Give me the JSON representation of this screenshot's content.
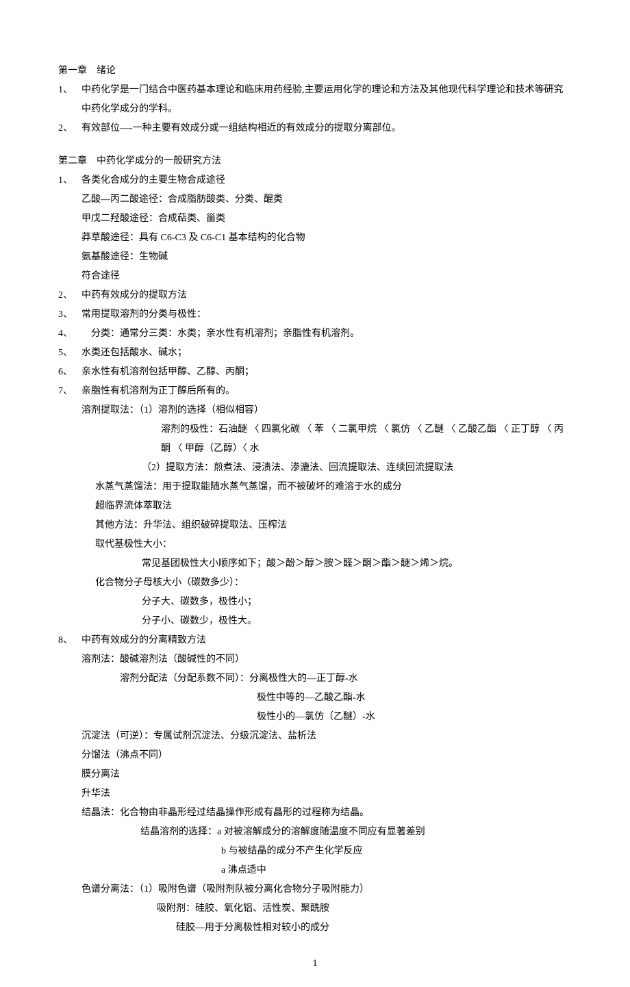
{
  "chapter1": {
    "title": "第一章　绪论",
    "items": [
      {
        "num": "1、",
        "text": "中药化学是一门结合中医药基本理论和临床用药经验,主要运用化学的理论和方法及其他现代科学理论和技术等研究中药化学成分的学科。"
      },
      {
        "num": "2、",
        "text": "有效部位—-一种主要有效成分或一组结构相近的有效成分的提取分离部位。"
      }
    ]
  },
  "chapter2": {
    "title": "第二章　中药化学成分的一般研究方法",
    "items": [
      {
        "num": "1、",
        "text": "各类化合成分的主要生物合成途径"
      },
      {
        "sub": "乙酸—丙二酸途径：合成脂肪酸类、分类、醌类"
      },
      {
        "sub": "甲戊二羟酸途径：合成萜类、甾类"
      },
      {
        "sub": "莽草酸途径：具有 C6-C3 及 C6-C1 基本结构的化合物"
      },
      {
        "sub": "氨基酸途径：生物碱"
      },
      {
        "sub": "符合途径"
      },
      {
        "num": "2、",
        "text": "中药有效成分的提取方法"
      },
      {
        "num": "3、",
        "text": "常用提取溶剂的分类与极性："
      },
      {
        "num": "4、",
        "text": "　分类：通常分三类：水类；亲水性有机溶剂；亲脂性有机溶剂。"
      },
      {
        "num": "5、",
        "text": "水类还包括酸水、碱水；"
      },
      {
        "num": "6、",
        "text": "亲水性有机溶剂包括甲醇、乙醇、丙酮；"
      },
      {
        "num": "7、",
        "text": "亲脂性有机溶剂为正丁醇后所有的。"
      },
      {
        "sub": "溶剂提取法：（1）溶剂的选择（相似相容）"
      },
      {
        "deep2": "溶剂的极性：石油醚 〈 四氯化碳 〈 苯 〈 二氯甲烷 〈 氯仿 〈 乙醚 〈 乙酸乙酯 〈 正丁醇 〈 丙酮 〈 甲醇（乙醇）〈 水"
      },
      {
        "deep": "（2）提取方法：煎煮法、浸渍法、渗漉法、回流提取法、连续回流提取法"
      },
      {
        "sub2": "水蒸气蒸馏法：用于提取能随水蒸气蒸馏，而不被破坏的难溶于水的成分"
      },
      {
        "sub2": "超临界流体萃取法"
      },
      {
        "sub2": "其他方法：升华法、组织破碎提取法、压榨法"
      },
      {
        "sub2": "取代基极性大小："
      },
      {
        "deep3": "常见基团极性大小顺序如下；酸＞酚＞醇＞胺＞醛＞酮＞酯＞醚＞烯＞烷。"
      },
      {
        "sub2": "化合物分子母核大小（碳数多少）："
      },
      {
        "deep3": "分子大、碳数多，极性小；"
      },
      {
        "deep3": "分子小、碳数少，极性大。"
      },
      {
        "num": "8、",
        "text": "中药有效成分的分离精致方法"
      },
      {
        "sub": "溶剂法：酸碱溶剂法（酸碱性的不同）"
      },
      {
        "mid2": "溶剂分配法（分配系数不同）：分离极性大的—正丁醇-水"
      },
      {
        "deepx": "极性中等的—乙酸乙酯-水"
      },
      {
        "deepx": "极性小的—氯仿（乙醚）-水"
      },
      {
        "sub": "沉淀法（可逆）：专属试剂沉淀法、分级沉淀法、盐析法"
      },
      {
        "sub": "分馏法（沸点不同）"
      },
      {
        "sub": "膜分离法"
      },
      {
        "sub": "升华法"
      },
      {
        "sub": "结晶法：化合物由非晶形经过结晶操作形成有晶形的过程称为结晶。"
      },
      {
        "deep4": "结晶溶剂的选择：a 对被溶解成分的溶解度随温度不同应有显著差别"
      },
      {
        "deep5": "b 与被结晶的成分不产生化学反应"
      },
      {
        "deep5": "a 沸点适中"
      },
      {
        "sub": "色谱分离法：（1）吸附色谱（吸附剂队被分离化合物分子吸附能力）"
      },
      {
        "deep6": "吸附剂：硅胶、氧化铝、活性炭、聚酰胺"
      },
      {
        "deep7": "硅胶—用于分离极性相对较小的成分"
      }
    ]
  },
  "page_number": "1"
}
